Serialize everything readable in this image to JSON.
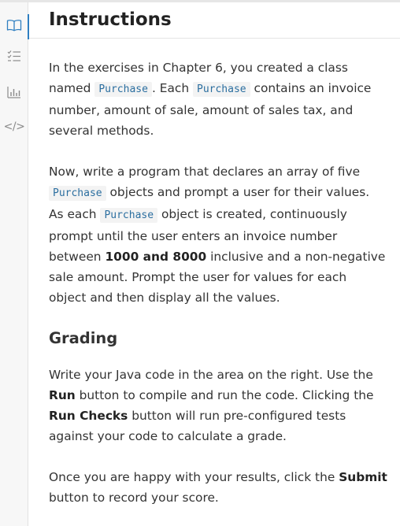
{
  "sidebar": {
    "icons": [
      "book-icon",
      "checklist-icon",
      "bar-chart-icon",
      "code-icon"
    ],
    "code_glyph": "</>"
  },
  "header": {
    "title": "Instructions"
  },
  "intro": {
    "t1": "In the exercises in Chapter 6, you created a class named ",
    "code1": "Purchase",
    "t2": ". Each ",
    "code2": "Purchase",
    "t3": " contains an invoice number, amount of sale, amount of sales tax, and several methods."
  },
  "task": {
    "t1": "Now, write a program that declares an array of five ",
    "code1": "Purchase",
    "t2": " objects and prompt a user for their values. As each ",
    "code2": "Purchase",
    "t3": " object is created, continuously prompt until the user enters an invoice number between ",
    "bold1": "1000 and 8000",
    "t4": " inclusive and a non-negative sale amount. Prompt the user for values for each object and then display all the values."
  },
  "grading": {
    "heading": "Grading",
    "t1": "Write your Java code in the area on the right. Use the ",
    "run": "Run",
    "t2": " button to compile and run the code. Clicking the ",
    "run_checks": "Run Checks",
    "t3": " button will run pre-configured tests against your code to calculate a grade."
  },
  "submit": {
    "t1": "Once you are happy with your results, click the ",
    "submit": "Submit",
    "t2": " button to record your score."
  },
  "colors": {
    "accent": "#2f7fc1",
    "code_text": "#2c6fa0"
  }
}
